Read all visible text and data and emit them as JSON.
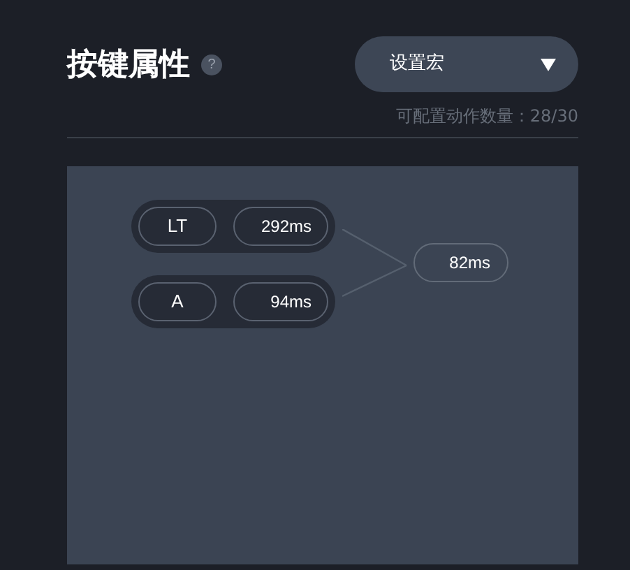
{
  "header": {
    "title": "按键属性",
    "help": "?"
  },
  "mode_dropdown": {
    "value": "设置宏"
  },
  "action_count": "可配置动作数量：28/30",
  "macro": {
    "steps": [
      {
        "key": "LT",
        "duration": "292ms"
      },
      {
        "key": "A",
        "duration": "94ms"
      }
    ],
    "result": "82ms"
  }
}
